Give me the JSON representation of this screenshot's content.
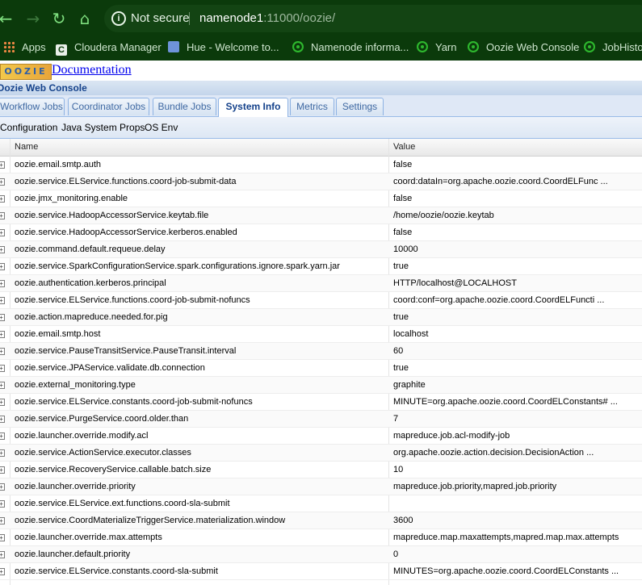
{
  "browser": {
    "security_label": "Not secure",
    "url_host": "namenode1",
    "url_rest": ":11000/oozie/",
    "bookmarks": [
      "Apps",
      "Cloudera Manager",
      "Hue - Welcome to...",
      "Namenode informa...",
      "Yarn",
      "Oozie Web Console",
      "JobHistor"
    ]
  },
  "page": {
    "logo_text": "OOZIE",
    "documentation_link": "Documentation",
    "console_title": "Oozie Web Console"
  },
  "tabs": [
    "Workflow Jobs",
    "Coordinator Jobs",
    "Bundle Jobs",
    "System Info",
    "Metrics",
    "Settings"
  ],
  "active_tab": "System Info",
  "subtabs": [
    "Configuration",
    "Java System Props",
    "OS Env"
  ],
  "grid": {
    "columns": [
      "Name",
      "Value"
    ],
    "rows": [
      [
        "oozie.email.smtp.auth",
        "false"
      ],
      [
        "oozie.service.ELService.functions.coord-job-submit-data",
        "coord:dataIn=org.apache.oozie.coord.CoordELFunc ..."
      ],
      [
        "oozie.jmx_monitoring.enable",
        "false"
      ],
      [
        "oozie.service.HadoopAccessorService.keytab.file",
        "/home/oozie/oozie.keytab"
      ],
      [
        "oozie.service.HadoopAccessorService.kerberos.enabled",
        "false"
      ],
      [
        "oozie.command.default.requeue.delay",
        "10000"
      ],
      [
        "oozie.service.SparkConfigurationService.spark.configurations.ignore.spark.yarn.jar",
        "true"
      ],
      [
        "oozie.authentication.kerberos.principal",
        "HTTP/localhost@LOCALHOST"
      ],
      [
        "oozie.service.ELService.functions.coord-job-submit-nofuncs",
        "coord:conf=org.apache.oozie.coord.CoordELFuncti ..."
      ],
      [
        "oozie.action.mapreduce.needed.for.pig",
        "true"
      ],
      [
        "oozie.email.smtp.host",
        "localhost"
      ],
      [
        "oozie.service.PauseTransitService.PauseTransit.interval",
        "60"
      ],
      [
        "oozie.service.JPAService.validate.db.connection",
        "true"
      ],
      [
        "oozie.external_monitoring.type",
        "graphite"
      ],
      [
        "oozie.service.ELService.constants.coord-job-submit-nofuncs",
        "MINUTE=org.apache.oozie.coord.CoordELConstants# ..."
      ],
      [
        "oozie.service.PurgeService.coord.older.than",
        "7"
      ],
      [
        "oozie.launcher.override.modify.acl",
        "mapreduce.job.acl-modify-job"
      ],
      [
        "oozie.service.ActionService.executor.classes",
        "org.apache.oozie.action.decision.DecisionAction ..."
      ],
      [
        "oozie.service.RecoveryService.callable.batch.size",
        "10"
      ],
      [
        "oozie.launcher.override.priority",
        "mapreduce.job.priority,mapred.job.priority"
      ],
      [
        "oozie.service.ELService.ext.functions.coord-sla-submit",
        ""
      ],
      [
        "oozie.service.CoordMaterializeTriggerService.materialization.window",
        "3600"
      ],
      [
        "oozie.launcher.override.max.attempts",
        "mapreduce.map.maxattempts,mapred.map.max.attempts"
      ],
      [
        "oozie.launcher.default.priority",
        "0"
      ],
      [
        "oozie.service.ELService.constants.coord-sla-submit",
        "MINUTES=org.apache.oozie.coord.CoordELConstants ..."
      ]
    ]
  }
}
